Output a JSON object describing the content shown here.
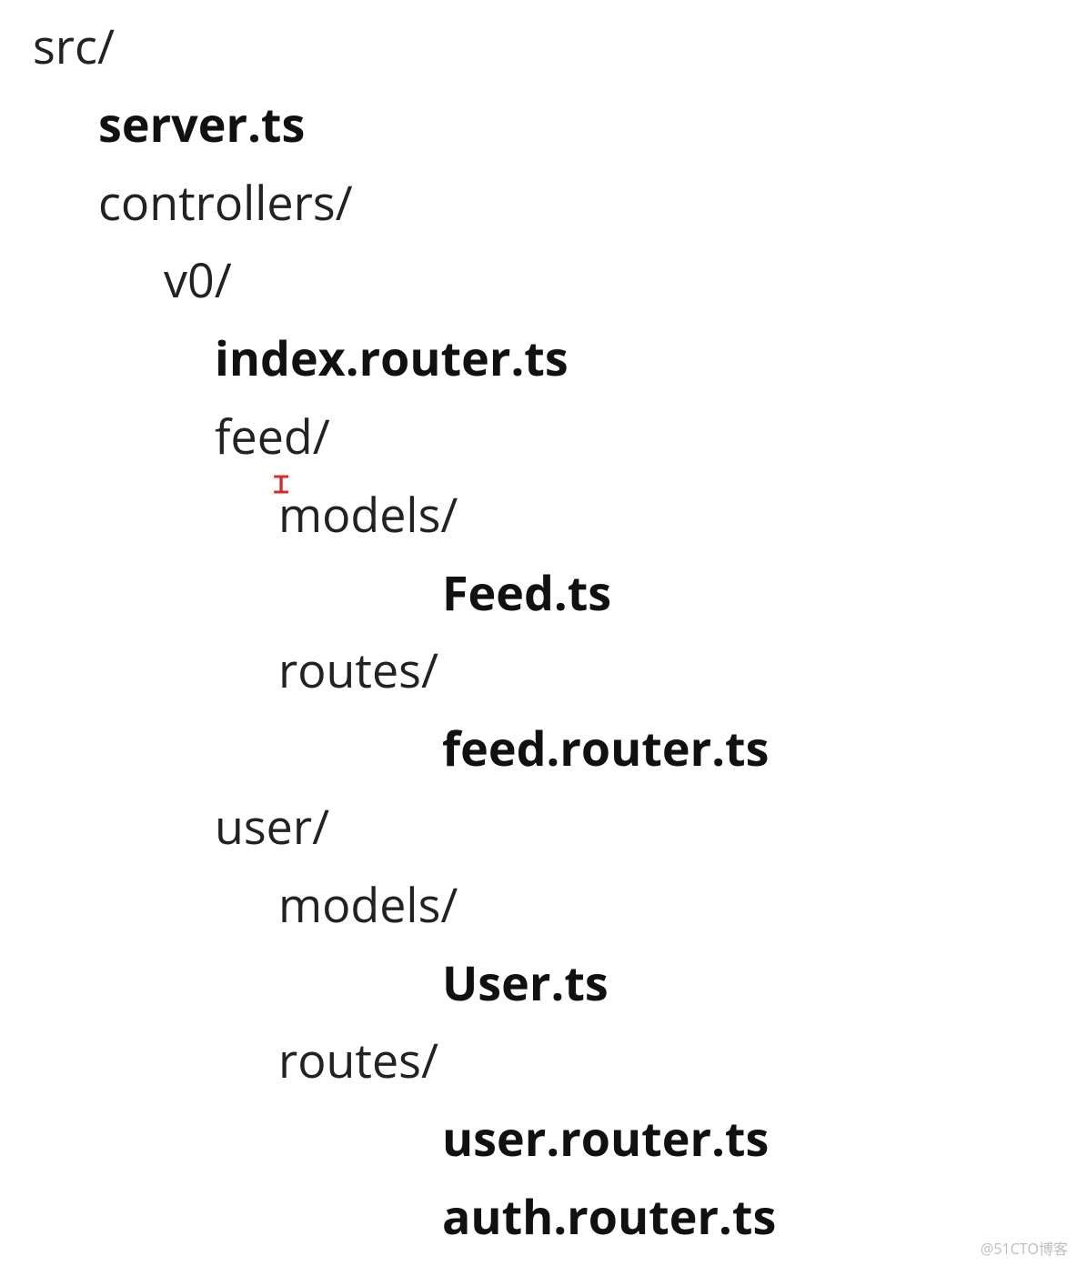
{
  "tree": {
    "lines": [
      {
        "text": "src/",
        "bold": false,
        "indent": 0
      },
      {
        "text": "server.ts",
        "bold": true,
        "indent": 1
      },
      {
        "text": "controllers/",
        "bold": false,
        "indent": 1
      },
      {
        "text": "v0/",
        "bold": false,
        "indent": 2
      },
      {
        "text": "index.router.ts",
        "bold": true,
        "indent": 3
      },
      {
        "text": "feed/",
        "bold": false,
        "indent": 3
      },
      {
        "text": "models/",
        "bold": false,
        "indent": 4,
        "cursor": true
      },
      {
        "text": "Feed.ts",
        "bold": true,
        "indent": 5
      },
      {
        "text": "routes/",
        "bold": false,
        "indent": 4
      },
      {
        "text": "feed.router.ts",
        "bold": true,
        "indent": 5
      },
      {
        "text": "user/",
        "bold": false,
        "indent": 3
      },
      {
        "text": "models/",
        "bold": false,
        "indent": 4
      },
      {
        "text": "User.ts",
        "bold": true,
        "indent": 5
      },
      {
        "text": "routes/",
        "bold": false,
        "indent": 4
      },
      {
        "text": "user.router.ts",
        "bold": true,
        "indent": 5
      },
      {
        "text": "auth.router.ts",
        "bold": true,
        "indent": 5
      }
    ]
  },
  "watermark": "@51CTO博客"
}
